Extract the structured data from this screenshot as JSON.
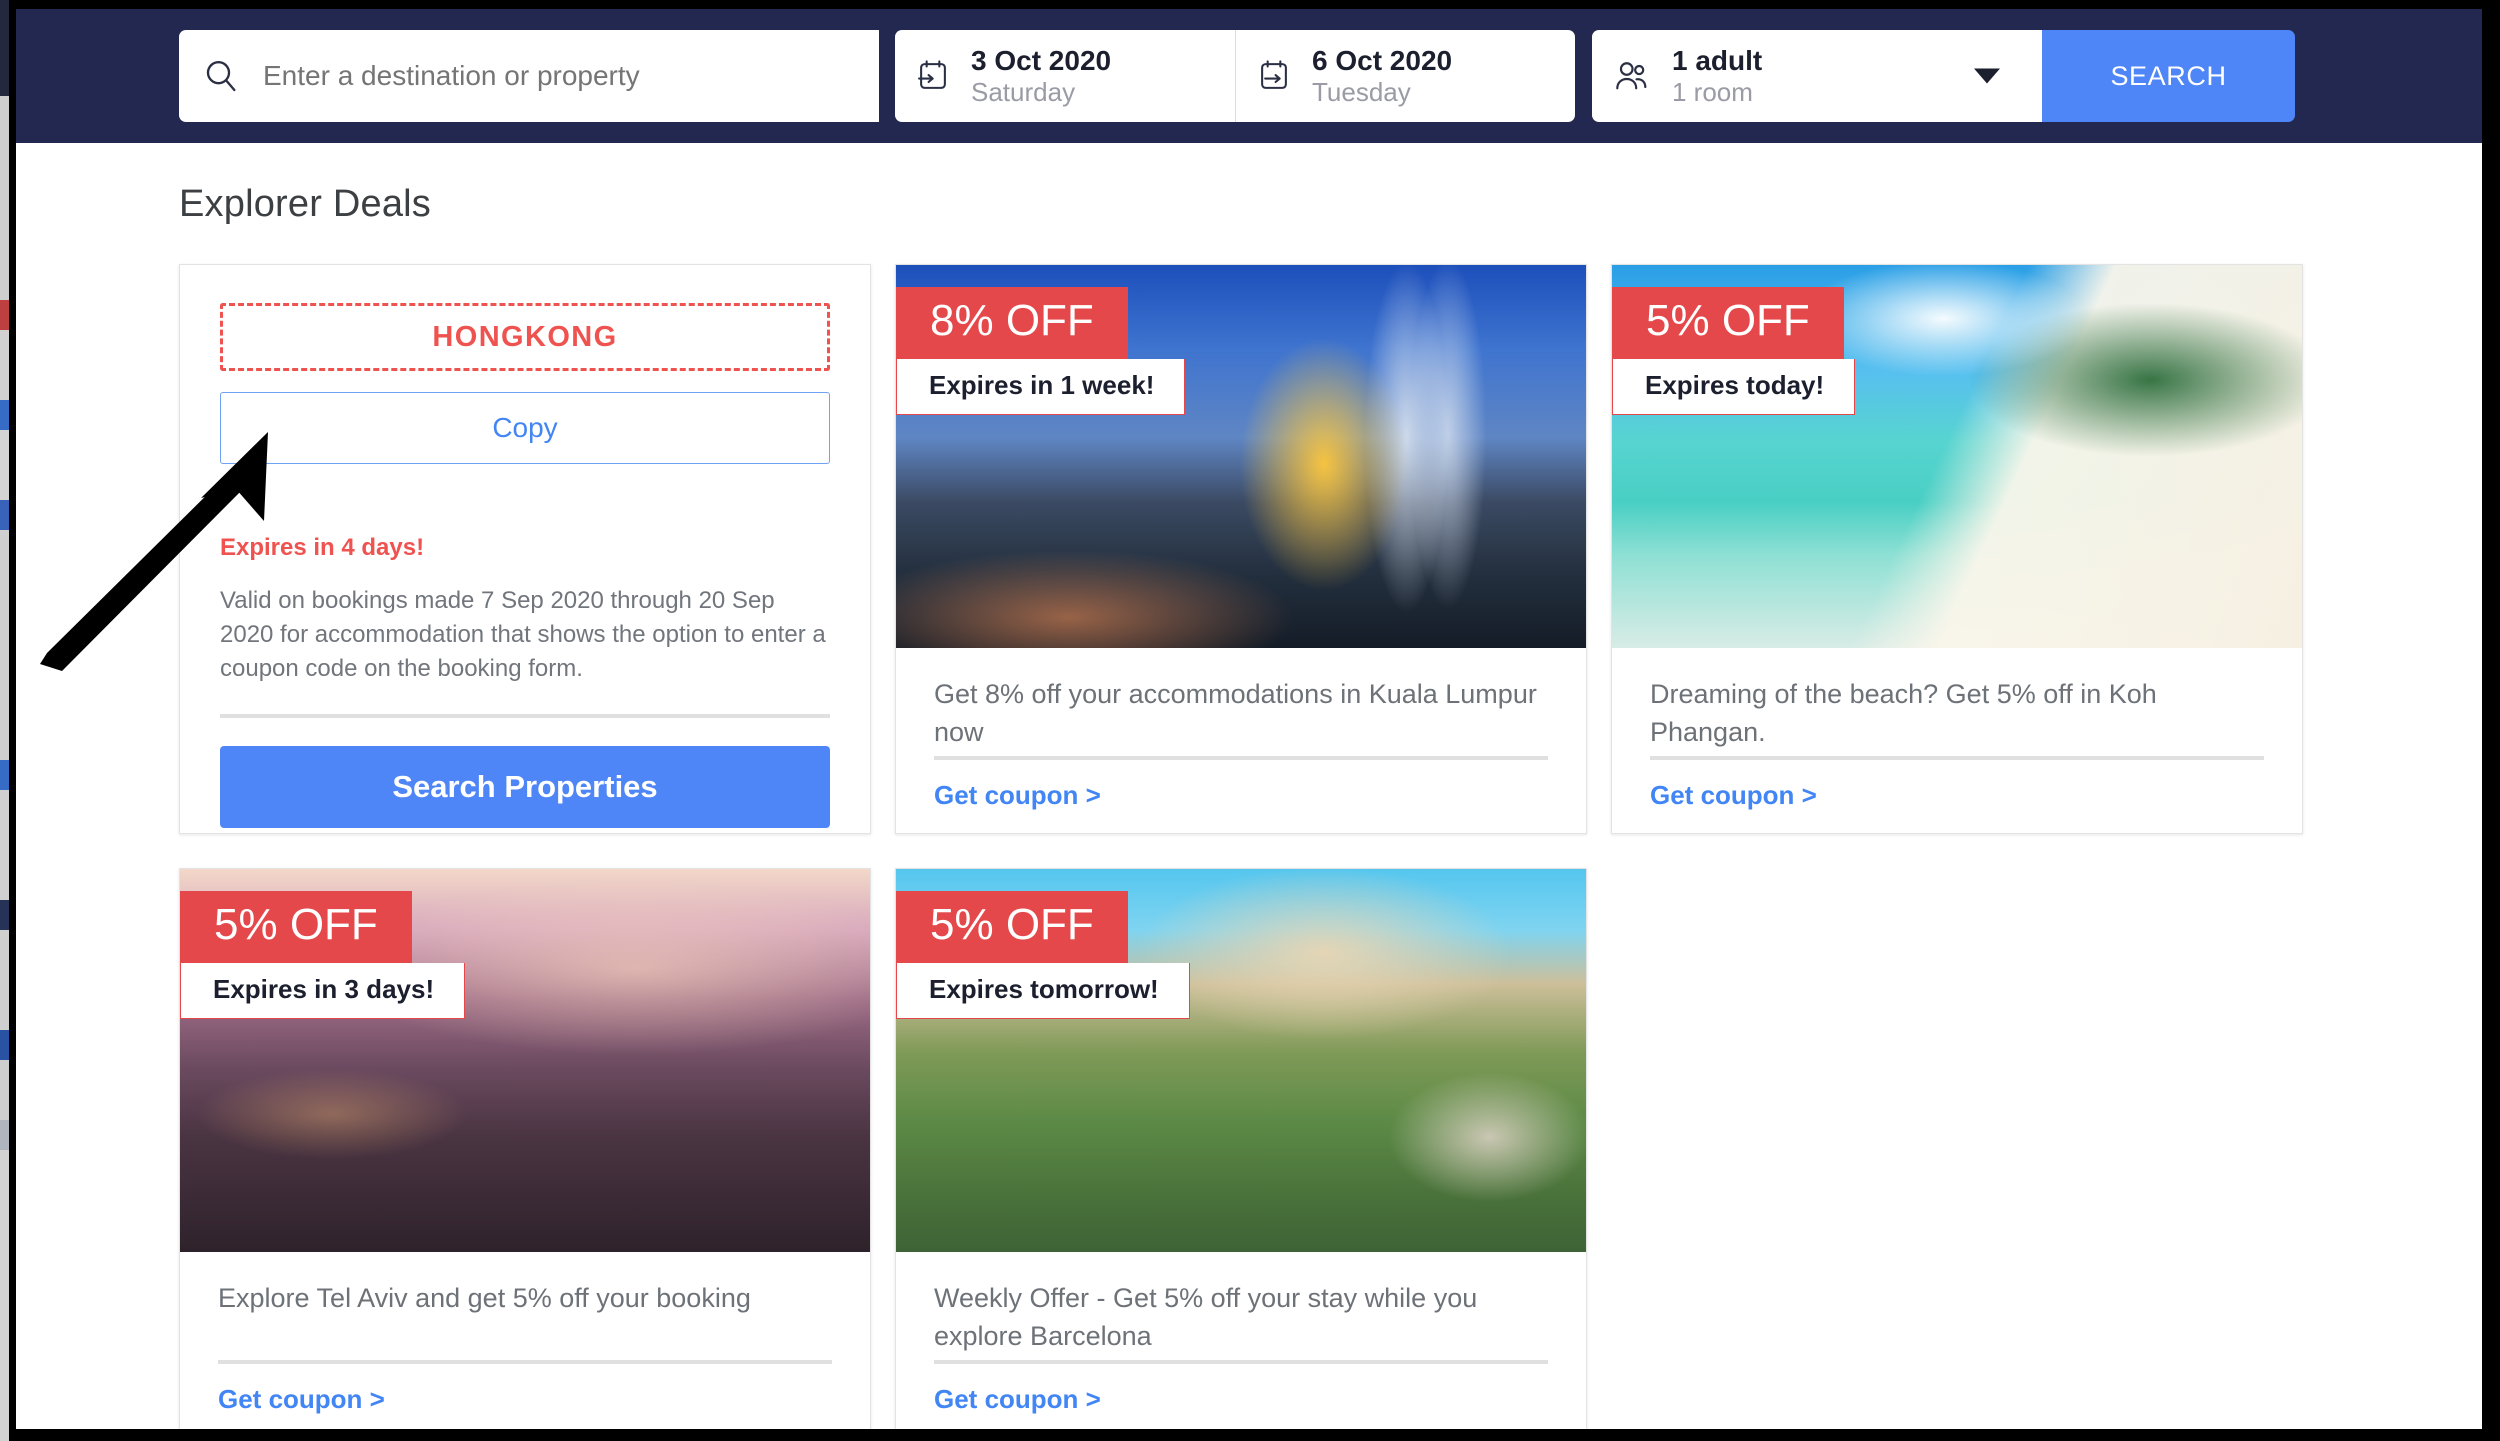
{
  "header": {
    "search": {
      "destination_placeholder": "Enter a destination or property",
      "destination_value": "",
      "search_icon": "search-icon",
      "checkin": {
        "icon": "calendar-checkin-icon",
        "date": "3 Oct 2020",
        "weekday": "Saturday"
      },
      "checkout": {
        "icon": "calendar-checkout-icon",
        "date": "6 Oct 2020",
        "weekday": "Tuesday"
      },
      "guests": {
        "icon": "guests-icon",
        "occupancy": "1 adult",
        "rooms": "1 room",
        "caret_icon": "chevron-down-icon"
      },
      "search_button": "SEARCH"
    },
    "accent_navy": "#222850",
    "accent_blue": "#4f86f7"
  },
  "main": {
    "page_title": "Explorer Deals",
    "coupon_card": {
      "code": "HONGKONG",
      "copy_label": "Copy",
      "expires": "Expires in 4 days!",
      "terms": "Valid on bookings made 7 Sep 2020 through 20 Sep 2020 for accommodation that shows the option to enter a coupon code on the booking form.",
      "cta": "Search Properties",
      "code_color": "#ef5350",
      "cta_color": "#4f86f7"
    },
    "deal_cards": [
      {
        "discount": "8% OFF",
        "expires": "Expires in 1 week!",
        "title": "Get 8% off your accommodations in Kuala Lumpur now",
        "link": "Get coupon >",
        "image_alt": "kuala-lumpur-skyline-photo"
      },
      {
        "discount": "5% OFF",
        "expires": "Expires today!",
        "title": "Dreaming of the beach? Get 5% off in Koh Phangan.",
        "link": "Get coupon >",
        "image_alt": "koh-phangan-beach-photo"
      },
      {
        "discount": "5% OFF",
        "expires": "Expires in 3 days!",
        "title": "Explore Tel Aviv and get 5% off your booking",
        "link": "Get coupon >",
        "image_alt": "tel-aviv-aerial-photo"
      },
      {
        "discount": "5% OFF",
        "expires": "Expires tomorrow!",
        "title": "Weekly Offer - Get 5% off your stay while you explore Barcelona",
        "link": "Get coupon >",
        "image_alt": "barcelona-montjuic-photo"
      }
    ],
    "badge_red": "#e5484a",
    "link_blue": "#4285f4"
  },
  "annotation": {
    "arrow_icon": "annotation-arrow-icon",
    "arrow_color": "#000000"
  }
}
